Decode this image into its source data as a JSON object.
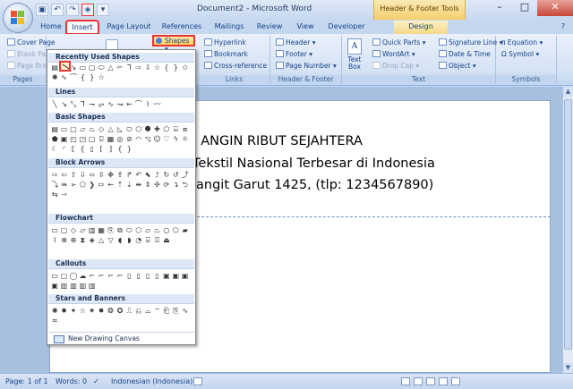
{
  "window": {
    "title": "Document2 - Microsoft Word",
    "contextual_tab_group": "Header & Footer Tools"
  },
  "tabs": [
    {
      "label": "Home"
    },
    {
      "label": "Insert"
    },
    {
      "label": "Page Layout"
    },
    {
      "label": "References"
    },
    {
      "label": "Mailings"
    },
    {
      "label": "Review"
    },
    {
      "label": "View"
    },
    {
      "label": "Developer"
    },
    {
      "label": "Design"
    }
  ],
  "ribbon": {
    "pages": {
      "label": "Pages",
      "cover_page": "Cover Page",
      "blank_page": "Blank Pa",
      "page_break": "Page Brea"
    },
    "illustrations": {
      "shapes": "Shapes"
    },
    "links": {
      "label": "Links",
      "hyperlink": "Hyperlink",
      "bookmark": "Bookmark",
      "cross_reference": "Cross-reference"
    },
    "header_footer": {
      "label": "Header & Footer",
      "header": "Header",
      "footer": "Footer",
      "page_number": "Page Number"
    },
    "text": {
      "label": "Text",
      "text_box_line1": "Text",
      "text_box_line2": "Box",
      "quick_parts": "Quick Parts",
      "wordart": "WordArt",
      "drop_cap": "Drop Cap",
      "signature_line": "Signature Line",
      "date_time": "Date & Time",
      "object": "Object"
    },
    "symbols": {
      "label": "Symbols",
      "equation": "Equation",
      "symbol": "Symbol"
    }
  },
  "shapes_menu": {
    "recently_used": "Recently Used Shapes",
    "lines": "Lines",
    "basic_shapes": "Basic Shapes",
    "block_arrows": "Block Arrows",
    "flowchart": "Flowchart",
    "callouts": "Callouts",
    "stars_banners": "Stars and Banners",
    "new_canvas": "New Drawing Canvas"
  },
  "document": {
    "line1": ". ANGIN RIBUT SEJAHTERA",
    "line2": "Tekstil Nasional Terbesar di Indonesia",
    "line3": "langit Garut 1425, (tlp: 1234567890)"
  },
  "status": {
    "page": "Page: 1 of 1",
    "words": "Words: 0",
    "language": "Indonesian (Indonesia)"
  },
  "colors": {
    "highlight": "#e33333",
    "ribbon": "#d6e3f5",
    "contextual": "#f4cf6b"
  }
}
